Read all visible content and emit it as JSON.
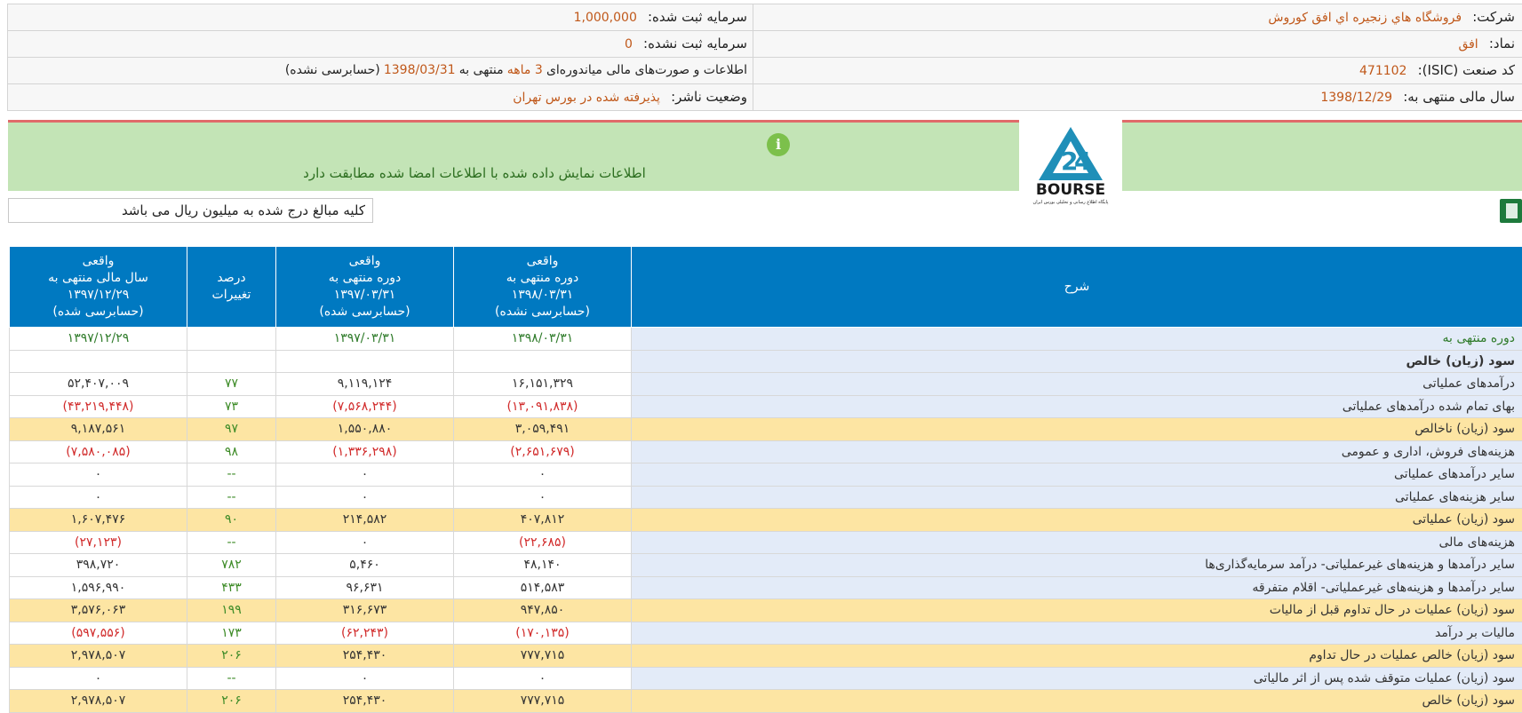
{
  "header": {
    "rows": [
      {
        "right": {
          "label": "شرکت:",
          "value": "فروشگاه هاي زنجيره اي افق كوروش"
        },
        "left": {
          "label": "سرمایه ثبت شده:",
          "value": "1,000,000"
        }
      },
      {
        "right": {
          "label": "نماد:",
          "value": "افق"
        },
        "left": {
          "label": "سرمایه ثبت نشده:",
          "value": "0"
        }
      },
      {
        "right": {
          "label": "کد صنعت (ISIC):",
          "value": "471102"
        },
        "left": {
          "label": "اطلاعات و صورت‌های مالی میاندوره‌ای",
          "period": "3 ماهه",
          "mid": "منتهی به",
          "date": "1398/03/31",
          "status": "(حسابرسی نشده)"
        }
      },
      {
        "right": {
          "label": "سال مالی منتهی به:",
          "value": "1398/12/29"
        },
        "left": {
          "label": "وضعیت ناشر:",
          "value": "پذیرفته شده در بورس تهران"
        }
      }
    ]
  },
  "banner": {
    "icon": "info-icon",
    "text": "اطلاعات نمایش داده شده با اطلاعات امضا شده مطابقت دارد",
    "logo_text": "BOURSE",
    "logo_caption": "پایگاه اطلاع رسانی و تحلیلی بورس ایران"
  },
  "note": "کلیه مبالغ درج شده به میلیون ریال می باشد",
  "excel_icon": "excel-icon",
  "table": {
    "headers": {
      "desc": "شرح",
      "c1": [
        "واقعی",
        "دوره منتهی به",
        "۱۳۹۸/۰۳/۳۱",
        "(حسابرسی نشده)"
      ],
      "c2": [
        "واقعی",
        "دوره منتهی به",
        "۱۳۹۷/۰۳/۳۱",
        "(حسابرسی شده)"
      ],
      "c3": [
        "درصد",
        "تغییرات"
      ],
      "c4": [
        "واقعی",
        "سال مالی منتهی به",
        "۱۳۹۷/۱۲/۲۹",
        "(حسابرسی شده)"
      ]
    },
    "rows": [
      {
        "desc": "دوره منتهی به",
        "c1": "۱۳۹۸/۰۳/۳۱",
        "c2": "۱۳۹۷/۰۳/۳۱",
        "c3": "",
        "c4": "۱۳۹۷/۱۲/۲۹",
        "type": "date"
      },
      {
        "desc": "سود (زیان) خالص",
        "c1": "",
        "c2": "",
        "c3": "",
        "c4": "",
        "type": "section"
      },
      {
        "desc": "درآمدهای عملیاتی",
        "c1": "۱۶,۱۵۱,۳۲۹",
        "c2": "۹,۱۱۹,۱۲۴",
        "c3": "۷۷",
        "c4": "۵۲,۴۰۷,۰۰۹"
      },
      {
        "desc": "بهای تمام شده درآمدهای عملیاتی",
        "c1": "(۱۳,۰۹۱,۸۳۸)",
        "c2": "(۷,۵۶۸,۲۴۴)",
        "c3": "۷۳",
        "c4": "(۴۳,۲۱۹,۴۴۸)",
        "neg": true
      },
      {
        "desc": "سود (زیان) ناخالص",
        "c1": "۳,۰۵۹,۴۹۱",
        "c2": "۱,۵۵۰,۸۸۰",
        "c3": "۹۷",
        "c4": "۹,۱۸۷,۵۶۱",
        "hl": true
      },
      {
        "desc": "هزینه‌های فروش، اداری و عمومی",
        "c1": "(۲,۶۵۱,۶۷۹)",
        "c2": "(۱,۳۳۶,۲۹۸)",
        "c3": "۹۸",
        "c4": "(۷,۵۸۰,۰۸۵)",
        "neg": true
      },
      {
        "desc": "سایر درآمدهای عملیاتی",
        "c1": "۰",
        "c2": "۰",
        "c3": "--",
        "c4": "۰"
      },
      {
        "desc": "سایر هزینه‌های عملیاتی",
        "c1": "۰",
        "c2": "۰",
        "c3": "--",
        "c4": "۰"
      },
      {
        "desc": "سود (زیان) عملیاتی",
        "c1": "۴۰۷,۸۱۲",
        "c2": "۲۱۴,۵۸۲",
        "c3": "۹۰",
        "c4": "۱,۶۰۷,۴۷۶",
        "hl": true
      },
      {
        "desc": "هزینه‌های مالی",
        "c1": "(۲۲,۶۸۵)",
        "c2": "۰",
        "c3": "--",
        "c4": "(۲۷,۱۲۳)",
        "negcols": [
          "c1",
          "c4"
        ]
      },
      {
        "desc": "سایر درآمدها و هزینه‌های غیرعملیاتی- درآمد سرمایه‌گذاری‌ها",
        "c1": "۴۸,۱۴۰",
        "c2": "۵,۴۶۰",
        "c3": "۷۸۲",
        "c4": "۳۹۸,۷۲۰"
      },
      {
        "desc": "سایر درآمدها و هزینه‌های غیرعملیاتی- اقلام متفرقه",
        "c1": "۵۱۴,۵۸۳",
        "c2": "۹۶,۶۳۱",
        "c3": "۴۳۳",
        "c4": "۱,۵۹۶,۹۹۰"
      },
      {
        "desc": "سود (زیان) عملیات در حال تداوم قبل از مالیات",
        "c1": "۹۴۷,۸۵۰",
        "c2": "۳۱۶,۶۷۳",
        "c3": "۱۹۹",
        "c4": "۳,۵۷۶,۰۶۳",
        "hl": true
      },
      {
        "desc": "مالیات بر درآمد",
        "c1": "(۱۷۰,۱۳۵)",
        "c2": "(۶۲,۲۴۳)",
        "c3": "۱۷۳",
        "c4": "(۵۹۷,۵۵۶)",
        "neg": true
      },
      {
        "desc": "سود (زیان) خالص عملیات در حال تداوم",
        "c1": "۷۷۷,۷۱۵",
        "c2": "۲۵۴,۴۳۰",
        "c3": "۲۰۶",
        "c4": "۲,۹۷۸,۵۰۷",
        "hl": true
      },
      {
        "desc": "سود (زیان) عملیات متوقف شده پس از اثر مالیاتی",
        "c1": "۰",
        "c2": "۰",
        "c3": "--",
        "c4": "۰"
      },
      {
        "desc": "سود (زیان) خالص",
        "c1": "۷۷۷,۷۱۵",
        "c2": "۲۵۴,۴۳۰",
        "c3": "۲۰۶",
        "c4": "۲,۹۷۸,۵۰۷",
        "hl": true
      }
    ]
  },
  "colors": {
    "header_blue": "#0079c1",
    "desc_bg": "#e3ebf8",
    "highlight_bg": "#fde5a3",
    "banner_bg": "#c3e4b6",
    "negative": "#d12a2a",
    "positive": "#2f7b2a",
    "orange_value": "#c0581a"
  }
}
